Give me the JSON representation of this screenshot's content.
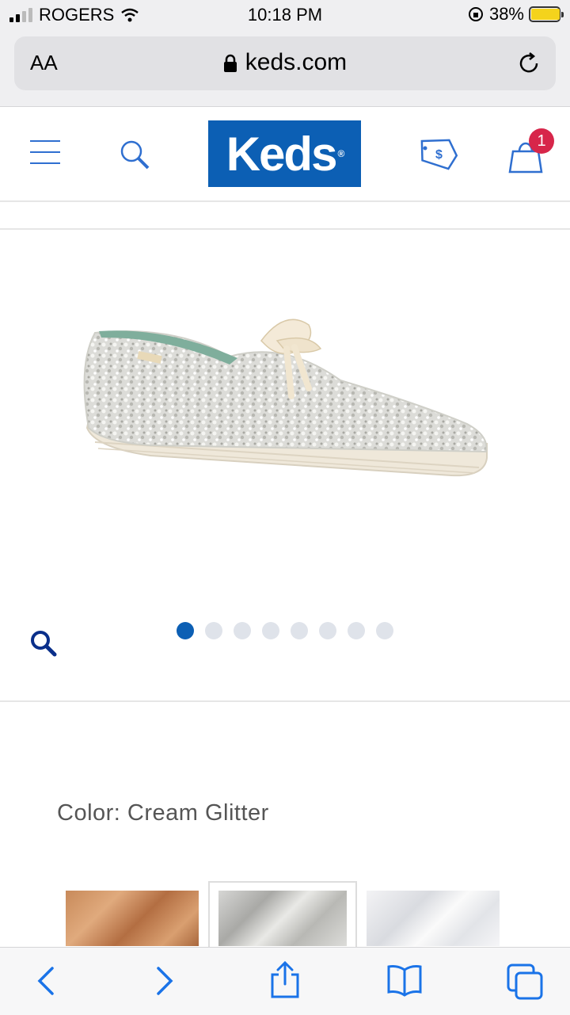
{
  "status_bar": {
    "carrier": "ROGERS",
    "time": "10:18 PM",
    "battery": "38%"
  },
  "address_bar": {
    "text_size_label": "AA",
    "domain": "keds.com"
  },
  "site_header": {
    "logo": "Keds",
    "cart_count": "1"
  },
  "gallery": {
    "image_count": 8,
    "active_index": 0
  },
  "product": {
    "color_label": "Color: Cream Glitter",
    "swatches": [
      "Rose Gold Glitter",
      "Cream Glitter",
      "Silver Glitter"
    ]
  },
  "colors": {
    "brand_blue": "#0c5fb4",
    "badge_red": "#d7264a",
    "ios_blue": "#1a73e8"
  }
}
